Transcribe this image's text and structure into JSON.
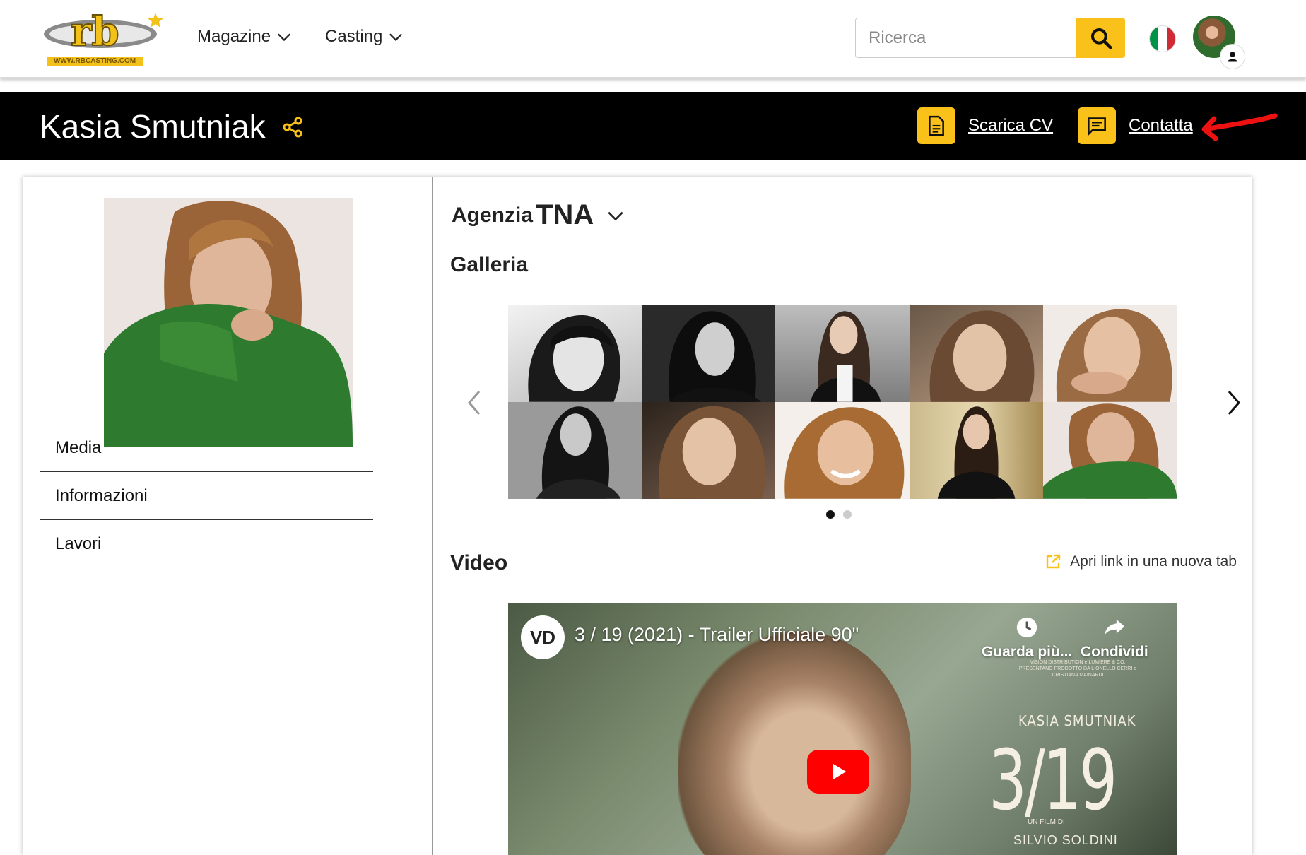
{
  "nav": {
    "logo_text": "rb",
    "logo_url_text": "WWW.RBCASTING.COM",
    "items": [
      {
        "label": "Magazine"
      },
      {
        "label": "Casting"
      }
    ],
    "search": {
      "placeholder": "Ricerca",
      "value": ""
    },
    "language": "Italiano",
    "colors": {
      "accent": "#f9c11a",
      "bar": "#000000"
    }
  },
  "profile": {
    "name": "Kasia Smutniak",
    "actions": {
      "download_cv": "Scarica CV",
      "contact": "Contatta"
    }
  },
  "sidebar": {
    "items": [
      {
        "label": "Media"
      },
      {
        "label": "Informazioni"
      },
      {
        "label": "Lavori"
      }
    ]
  },
  "main": {
    "agency_label": "Agenzia",
    "agency_value": "TNA",
    "gallery_title": "Galleria",
    "gallery_pages": 2,
    "gallery_active_page": 1,
    "video_title": "Video",
    "open_new_tab": "Apri link in una nuova tab",
    "video": {
      "title": "3 / 19 (2021) - Trailer Ufficiale 90\"",
      "channel_logo": "VD",
      "watch_later": "Guarda più...",
      "share": "Condividi",
      "poster_actor": "KASIA SMUTNIAK",
      "poster_title": "3/19",
      "poster_credit": "UN FILM DI",
      "poster_director": "SILVIO SOLDINI",
      "poster_production": "VISION DISTRIBUTION e LUMIERE & CO. PRESENTANO PRODOTTO DA LIONELLO CERRI e CRISTIANA MAINARDI"
    }
  }
}
